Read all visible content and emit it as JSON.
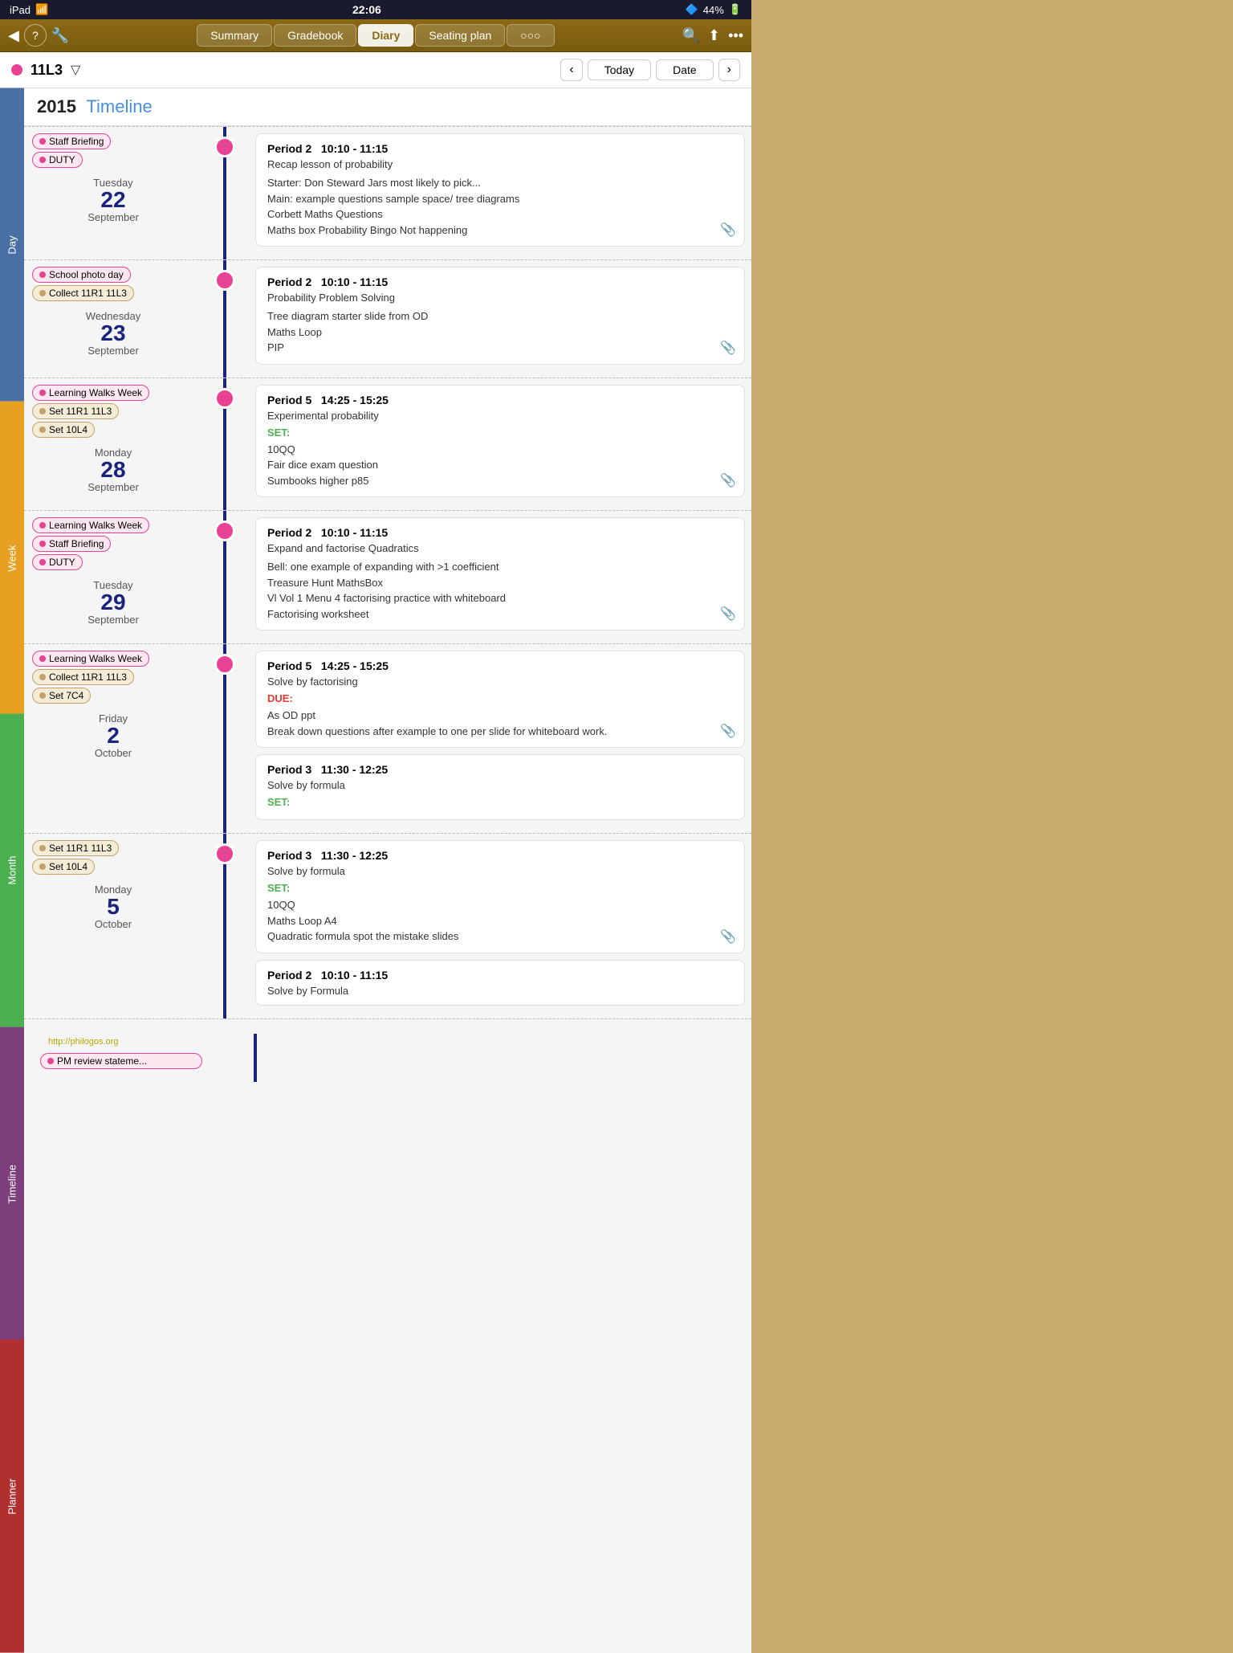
{
  "statusBar": {
    "left": "iPad",
    "wifi": "wifi",
    "time": "22:06",
    "bluetooth": "bluetooth",
    "battery": "44%"
  },
  "navBar": {
    "backIcon": "◀",
    "helpIcon": "?",
    "settingsIcon": "🔧",
    "tabs": [
      {
        "label": "Summary",
        "id": "summary"
      },
      {
        "label": "Gradebook",
        "id": "gradebook"
      },
      {
        "label": "Diary",
        "id": "diary",
        "active": true
      },
      {
        "label": "Seating plan",
        "id": "seating"
      },
      {
        "label": "○○○",
        "id": "more"
      }
    ],
    "searchIcon": "🔍",
    "shareIcon": "↑",
    "moreIcon": "•••"
  },
  "classBar": {
    "className": "11L3",
    "filterIcon": "▽",
    "prevArrow": "‹",
    "nextArrow": "›",
    "todayLabel": "Today",
    "dateLabel": "Date"
  },
  "yearHeader": {
    "year": "2015",
    "view": "Timeline"
  },
  "sideTabs": [
    {
      "label": "Day",
      "id": "day"
    },
    {
      "label": "Week",
      "id": "week"
    },
    {
      "label": "Month",
      "id": "month"
    },
    {
      "label": "Timeline",
      "id": "timeline",
      "active": true
    },
    {
      "label": "Planner",
      "id": "planner"
    }
  ],
  "sections": [
    {
      "id": "tue22sep",
      "dayName": "Tuesday",
      "dayNum": "22",
      "month": "September",
      "pills": [
        {
          "label": "Staff Briefing",
          "color": "pink"
        },
        {
          "label": "DUTY",
          "color": "pink"
        }
      ],
      "entries": [
        {
          "header": "Period 2   10:10 - 11:15",
          "subheader": "Recap lesson of probability",
          "body": "Starter: Don Steward Jars most likely to pick...\nMain: example questions sample space/ tree diagrams\nCorbett Maths Questions\nMaths box Probability Bingo Not happening",
          "hasClip": true
        }
      ]
    },
    {
      "id": "wed23sep",
      "dayName": "Wednesday",
      "dayNum": "23",
      "month": "September",
      "pills": [
        {
          "label": "School photo day",
          "color": "pink"
        },
        {
          "label": "Collect 11R1 11L3",
          "color": "tan"
        }
      ],
      "entries": [
        {
          "header": "Period 2   10:10 - 11:15",
          "subheader": "Probability Problem Solving",
          "body": "Tree diagram starter slide from OD\nMaths Loop\nPIP",
          "hasClip": true
        }
      ]
    },
    {
      "id": "mon28sep",
      "dayName": "Monday",
      "dayNum": "28",
      "month": "September",
      "pills": [
        {
          "label": "Learning Walks Week",
          "color": "pink"
        },
        {
          "label": "Set 11R1 11L3",
          "color": "tan"
        },
        {
          "label": "Set 10L4",
          "color": "tan"
        }
      ],
      "entries": [
        {
          "header": "Period 5   14:25 - 15:25",
          "subheader": "Experimental probability",
          "setLabel": "SET:",
          "body": "10QQ\nFair dice exam question\nSumbooks higher p85",
          "hasClip": true
        }
      ]
    },
    {
      "id": "tue29sep",
      "dayName": "Tuesday",
      "dayNum": "29",
      "month": "September",
      "pills": [
        {
          "label": "Learning Walks Week",
          "color": "pink"
        },
        {
          "label": "Staff Briefing",
          "color": "pink"
        },
        {
          "label": "DUTY",
          "color": "pink"
        }
      ],
      "entries": [
        {
          "header": "Period 2   10:10 - 11:15",
          "subheader": "Expand and factorise Quadratics",
          "body": "Bell: one example of expanding with >1 coefficient\nTreasure Hunt MathsBox\nVl Vol 1 Menu 4 factorising practice with whiteboard\nFactorising worksheet",
          "hasClip": true
        }
      ]
    },
    {
      "id": "fri2oct",
      "dayName": "Friday",
      "dayNum": "2",
      "month": "October",
      "pills": [
        {
          "label": "Learning Walks Week",
          "color": "pink"
        },
        {
          "label": "Collect 11R1 11L3",
          "color": "tan"
        },
        {
          "label": "Set 7C4",
          "color": "tan"
        }
      ],
      "entries": [
        {
          "header": "Period 5   14:25 - 15:25",
          "subheader": "Solve by factorising",
          "dueLabel": "DUE:",
          "body": "As OD ppt\nBreak down questions after example to one per slide for whiteboard work.",
          "hasClip": true
        },
        {
          "header": "Period 3   11:30 - 12:25",
          "subheader": "Solve by formula",
          "setLabel": "SET:",
          "body": "",
          "hasClip": false
        }
      ]
    },
    {
      "id": "mon5oct",
      "dayName": "Monday",
      "dayNum": "5",
      "month": "October",
      "pills": [
        {
          "label": "Set 11R1 11L3",
          "color": "tan"
        },
        {
          "label": "Set 10L4",
          "color": "tan"
        }
      ],
      "entries": [
        {
          "header": "Period 3   11:30 - 12:25",
          "subheader": "Solve by formula",
          "setLabel": "SET:",
          "body": "10QQ\nMaths Loop A4\nQuadratic formula spot the mistake slides",
          "hasClip": true
        },
        {
          "header": "Period 2   10:10 - 11:15",
          "subheader": "Solve by Formula",
          "body": "",
          "hasClip": false
        }
      ]
    }
  ],
  "watermark": "http://philogos.org",
  "bottomPill": {
    "label": "PM review stateme...",
    "color": "pink"
  }
}
